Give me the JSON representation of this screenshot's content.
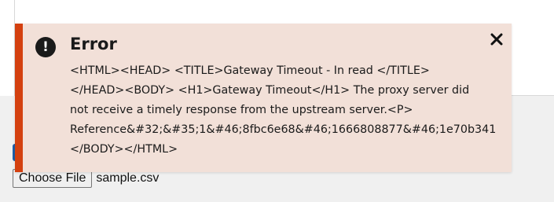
{
  "alert": {
    "icon": "exclamation-circle-icon",
    "icon_glyph": "!",
    "title": "Error",
    "close_icon": "close-icon",
    "message_lines": [
      "<HTML><HEAD> <TITLE>Gateway Timeout - In read </TITLE>",
      "</HEAD><BODY> <H1>Gateway Timeout</H1> The proxy server did",
      "not receive a timely response from the upstream server.<P>",
      "Reference&#32;&#35;1&#46;8fbc6e68&#46;1666808877&#46;1e70b341",
      "</BODY></HTML>"
    ],
    "accent_color": "#d4400f",
    "background_color": "#f2e0d8"
  },
  "file_input": {
    "button_label": "Choose File",
    "file_name": "sample.csv"
  }
}
